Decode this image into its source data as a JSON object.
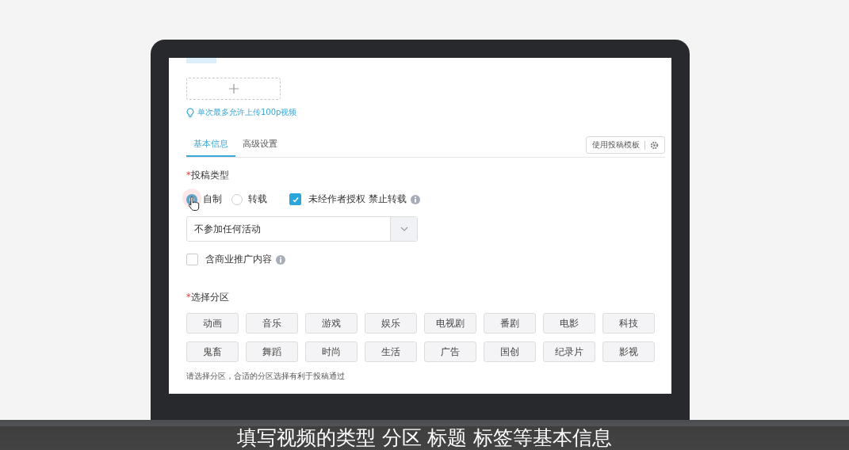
{
  "upload": {
    "hint": "单次最多允许上传100p视频"
  },
  "tabs": [
    {
      "label": "基本信息",
      "selected": true
    },
    {
      "label": "高级设置",
      "selected": false
    }
  ],
  "template_button": {
    "label": "使用投稿模板"
  },
  "submission_type": {
    "marker": "*",
    "label": "投稿类型",
    "options": [
      {
        "label": "自制",
        "selected": true
      },
      {
        "label": "转载",
        "selected": false
      }
    ],
    "no_repost": {
      "label": "未经作者授权 禁止转载",
      "checked": true
    }
  },
  "activity_select": {
    "value": "不参加任何活动"
  },
  "commercial": {
    "label": "含商业推广内容",
    "checked": false
  },
  "category": {
    "marker": "*",
    "label": "选择分区",
    "items": [
      {
        "label": "动画",
        "selected": false
      },
      {
        "label": "音乐",
        "selected": false
      },
      {
        "label": "游戏",
        "selected": false
      },
      {
        "label": "娱乐",
        "selected": false
      },
      {
        "label": "电视剧",
        "selected": false
      },
      {
        "label": "番剧",
        "selected": false
      },
      {
        "label": "电影",
        "selected": false
      },
      {
        "label": "科技",
        "selected": false
      },
      {
        "label": "鬼畜",
        "selected": false
      },
      {
        "label": "舞蹈",
        "selected": false
      },
      {
        "label": "时尚",
        "selected": false
      },
      {
        "label": "生活",
        "selected": false
      },
      {
        "label": "广告",
        "selected": false
      },
      {
        "label": "国创",
        "selected": false
      },
      {
        "label": "纪录片",
        "selected": false
      },
      {
        "label": "影视",
        "selected": false
      }
    ],
    "hint": "请选择分区，合适的分区选择有利于投稿通过"
  },
  "subtitle": "填写视频的类型 分区 标题 标签等基本信息"
}
